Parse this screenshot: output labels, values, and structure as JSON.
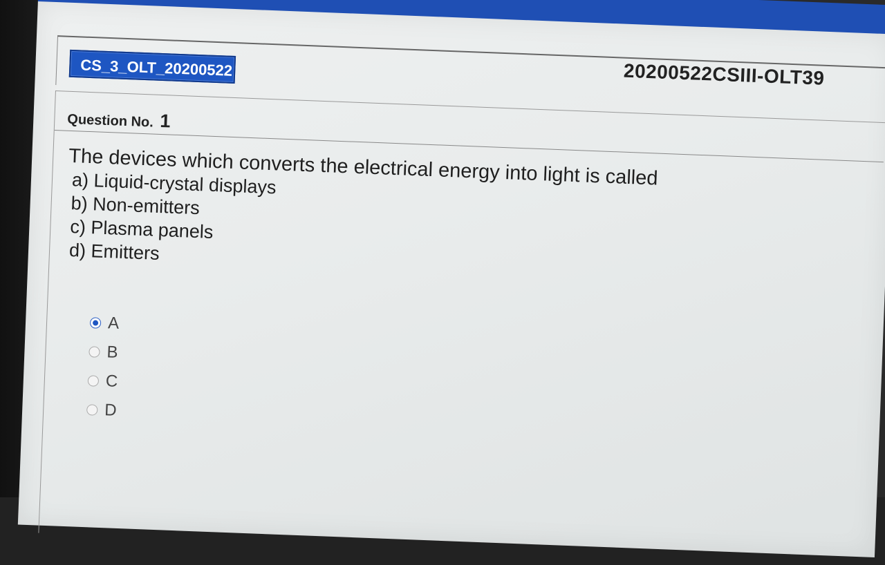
{
  "header": {
    "exam_id": "20200522CSIII-OLT39",
    "tab_label": "CS_3_OLT_20200522"
  },
  "question": {
    "label": "Question No.",
    "number": "1",
    "text": "The devices which converts the electrical energy into light is called",
    "options": [
      "a) Liquid-crystal displays",
      "b) Non-emitters",
      "c) Plasma panels",
      "d) Emitters"
    ]
  },
  "answers": {
    "choices": [
      "A",
      "B",
      "C",
      "D"
    ],
    "selected": "A"
  }
}
